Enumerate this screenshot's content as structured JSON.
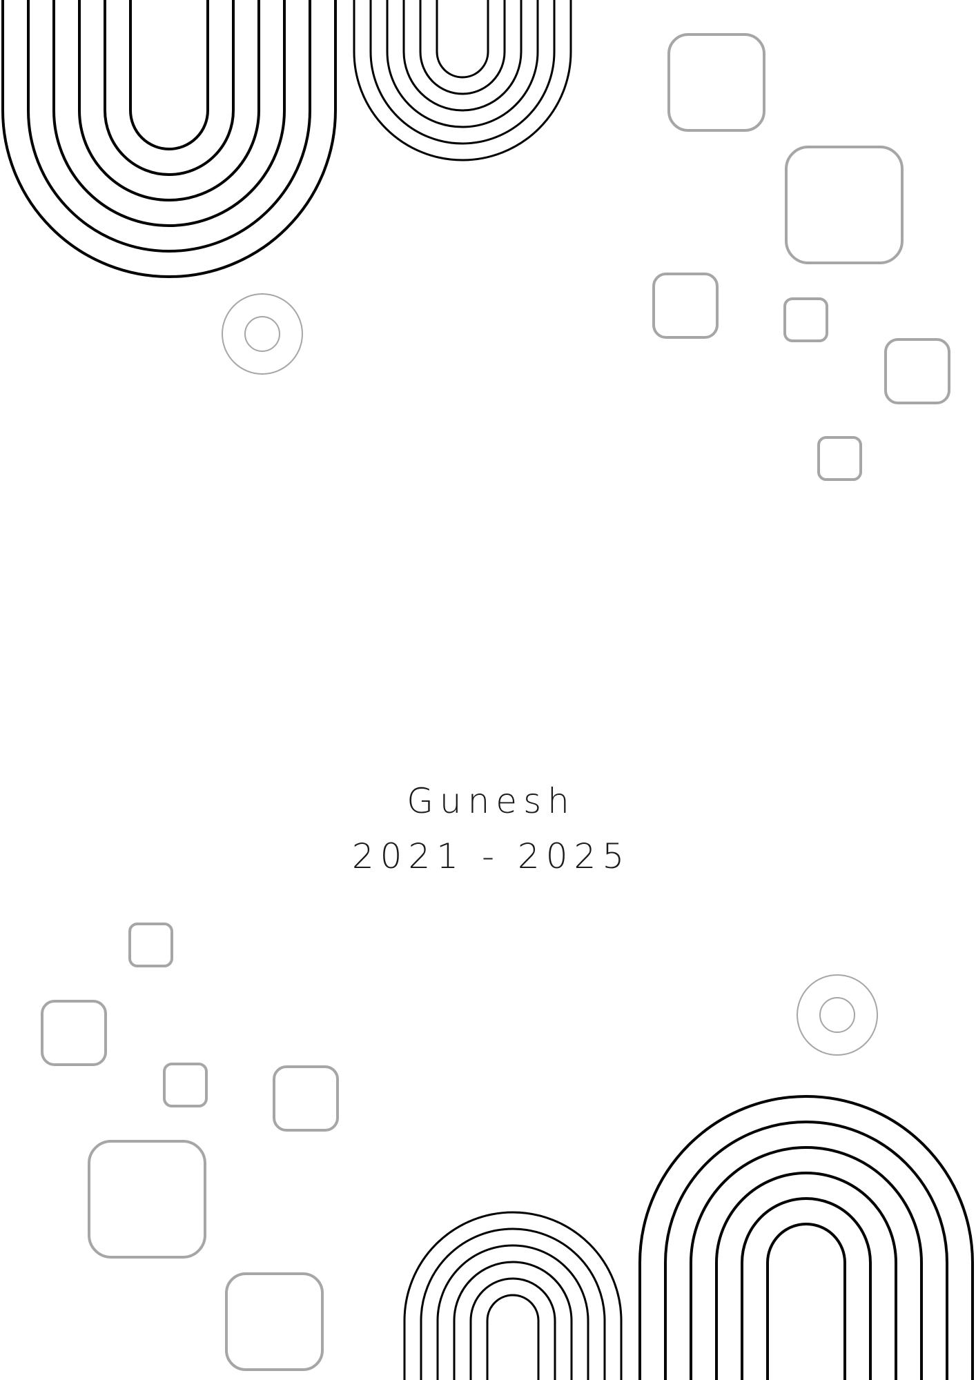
{
  "cover": {
    "name": "Gunesh",
    "years": "2021 - 2025"
  },
  "colors": {
    "background": "#ffffff",
    "arch_stroke": "#000000",
    "square_stroke": "#a6a6a6",
    "text": "#1a1a1a"
  },
  "icons": {
    "arch": "nested-arch-icon",
    "square": "rounded-square-icon",
    "ring": "double-ring-icon"
  }
}
